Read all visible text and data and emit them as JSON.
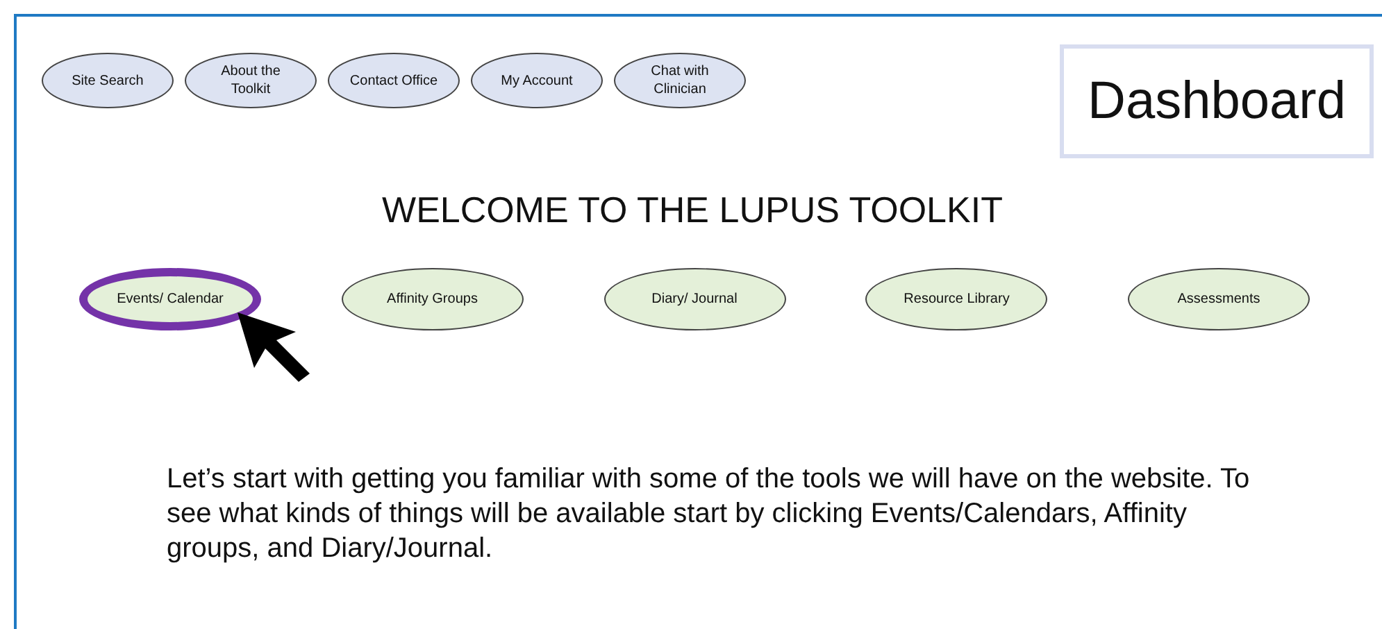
{
  "nav_buttons": [
    {
      "label": "Site Search"
    },
    {
      "label": "About the Toolkit"
    },
    {
      "label": "Contact Office"
    },
    {
      "label": "My Account"
    },
    {
      "label": "Chat with Clinician"
    }
  ],
  "page_title": "Dashboard",
  "heading": "WELCOME TO THE LUPUS TOOLKIT",
  "tools": [
    {
      "label": "Events/ Calendar",
      "selected": true
    },
    {
      "label": "Affinity Groups",
      "selected": false
    },
    {
      "label": "Diary/ Journal",
      "selected": false
    },
    {
      "label": "Resource Library",
      "selected": false
    },
    {
      "label": "Assessments",
      "selected": false
    }
  ],
  "instructions": "Let’s start with getting you familiar with some of the tools we will have on the website.  To see what kinds of things will be available start by clicking Events/Calendars, Affinity groups, and Diary/Journal."
}
